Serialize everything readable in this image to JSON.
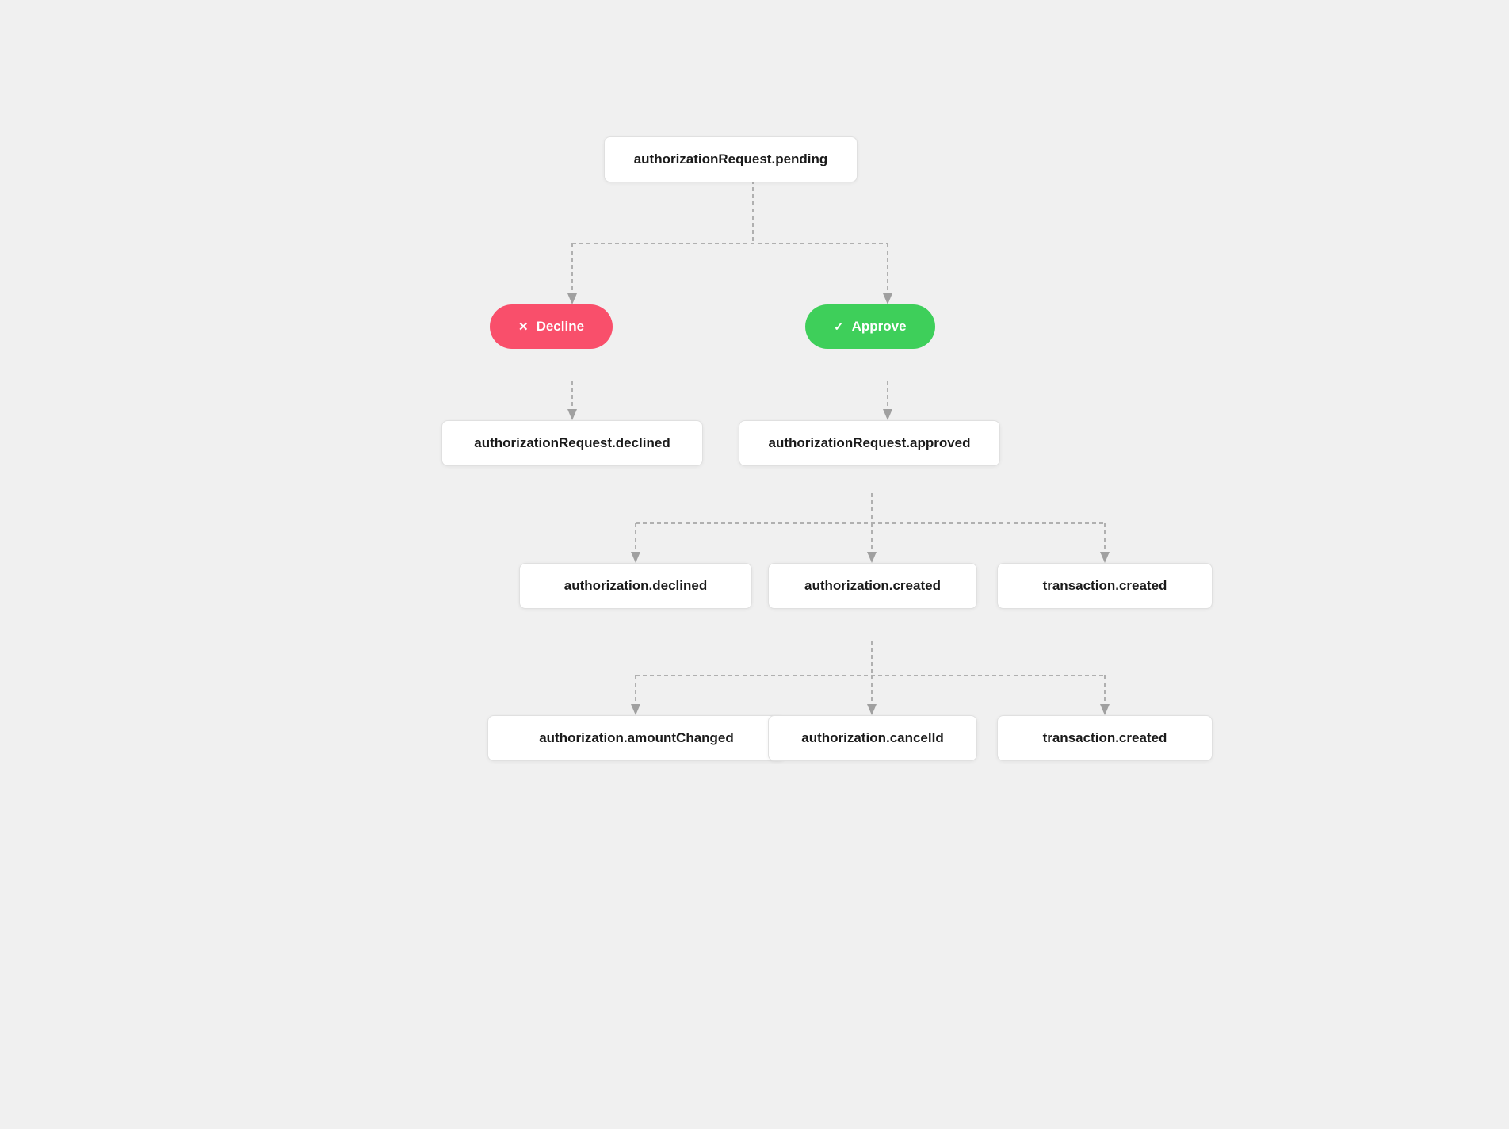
{
  "nodes": {
    "pending": "authorizationRequest.pending",
    "decline_btn": "✕ Decline",
    "approve_btn": "✓ Approve",
    "declined_req": "authorizationRequest.declined",
    "approved_req": "authorizationRequest.approved",
    "auth_declined": "authorization.declined",
    "auth_created": "authorization.created",
    "txn_created_1": "transaction.created",
    "auth_amount": "authorization.amountChanged",
    "auth_cancel": "authorization.cancelId",
    "txn_created_2": "transaction.created"
  }
}
